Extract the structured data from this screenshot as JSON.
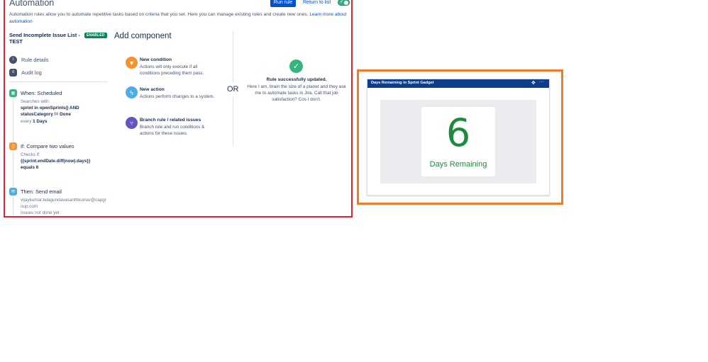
{
  "automation": {
    "title": "Automation",
    "run_rule_label": "Run rule",
    "return_label": "Return to list",
    "description": "Automation rules allow you to automate repetitive tasks based on criteria that you set. Here you can manage existing rules and create new ones.",
    "learn_more": "Learn more about automation",
    "rule_name": "Send Incomplete Issue List - TEST",
    "rule_status": "ENABLED",
    "side_links": [
      "Rule details",
      "Audit log"
    ],
    "steps": {
      "when": {
        "title": "When: Scheduled",
        "sub": "Searches with:",
        "query": "sprint in openSprints() AND statusCategory != Done",
        "every_prefix": "every",
        "every_value": "1 Days"
      },
      "if": {
        "title": "If: Compare two values",
        "sub": "Checks if:",
        "expression": "{{sprint.endDate.diff(now).days}}",
        "equals": "equals 6"
      },
      "then": {
        "title": "Then: Send email",
        "recipient": "vijaykumar.telagundavasanthkumar@capgroup.com",
        "subject": "Issues not done yet"
      }
    },
    "add_component": {
      "heading": "Add component",
      "items": [
        {
          "title": "New condition",
          "desc": "Actions will only execute if all conditions preceding them pass."
        },
        {
          "title": "New action",
          "desc": "Actions perform changes to a system."
        },
        {
          "title": "Branch rule / related issues",
          "desc": "Branch rule and run conditions & actions for these issues."
        }
      ]
    },
    "or_label": "OR",
    "success_title": "Rule successfully updated.",
    "success_message": "Here I am, brain the size of a planet and they ask me to automate tasks in Jira. Call that job satisfaction? Cos I don't.",
    "colors": {
      "primary": "#0052cc",
      "enabled": "#00875a",
      "condition": "#f79232",
      "action": "#4baee8",
      "branch": "#6554c0",
      "success": "#36b37e"
    }
  },
  "gadget": {
    "title": "Days Remaining in Sprint Gadget",
    "days_value": "6",
    "days_label": "Days Remaining",
    "colors": {
      "header": "#0c3e8c",
      "number": "#1e8a3e"
    }
  }
}
